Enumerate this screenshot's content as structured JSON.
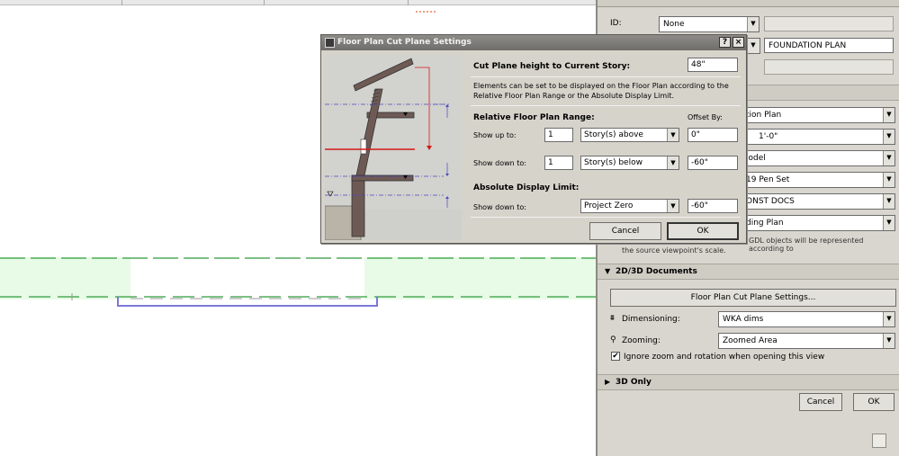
{
  "dialog": {
    "title": "Floor Plan Cut Plane Settings",
    "help_label": "?",
    "close_label": "×",
    "cut_plane_label": "Cut Plane height to Current Story:",
    "cut_plane_value": "48\"",
    "description": "Elements can be set to be displayed on the Floor Plan according to the Relative Floor Plan Range or the Absolute Display Limit.",
    "relative_heading": "Relative Floor Plan Range:",
    "offset_by_label": "Offset By:",
    "show_up_label": "Show up to:",
    "show_up_count": "1",
    "show_up_option": "Story(s) above",
    "show_up_offset": "0\"",
    "show_down_label": "Show down to:",
    "show_down_count": "1",
    "show_down_option": "Story(s) below",
    "show_down_offset": "-60\"",
    "absolute_heading": "Absolute Display Limit:",
    "abs_show_down_label": "Show down to:",
    "abs_option": "Project Zero",
    "abs_offset": "-60\"",
    "cancel_label": "Cancel",
    "ok_label": "OK"
  },
  "panel": {
    "id_label": "ID:",
    "id_value": "None",
    "name_value": "FOUNDATION PLAN",
    "selects": [
      "tion Plan",
      "1'-0\"",
      "lodel",
      "19 Pen Set",
      "ONST DOCS",
      "ding Plan"
    ],
    "gdl_note": "GDL objects will be represented according to",
    "gdl_note_2": "the source viewpoint's scale.",
    "section_2d3d": "2D/3D Documents",
    "cut_plane_button": "Floor Plan Cut Plane Settings...",
    "dimensioning_label": "Dimensioning:",
    "dimensioning_value": "WKA dims",
    "zooming_label": "Zooming:",
    "zooming_value": "Zoomed Area",
    "ignore_zoom_label": "Ignore zoom and rotation when opening this view",
    "ignore_zoom_checked": "✔",
    "section_3d": "3D Only",
    "cancel_label": "Cancel",
    "ok_label": "OK"
  }
}
